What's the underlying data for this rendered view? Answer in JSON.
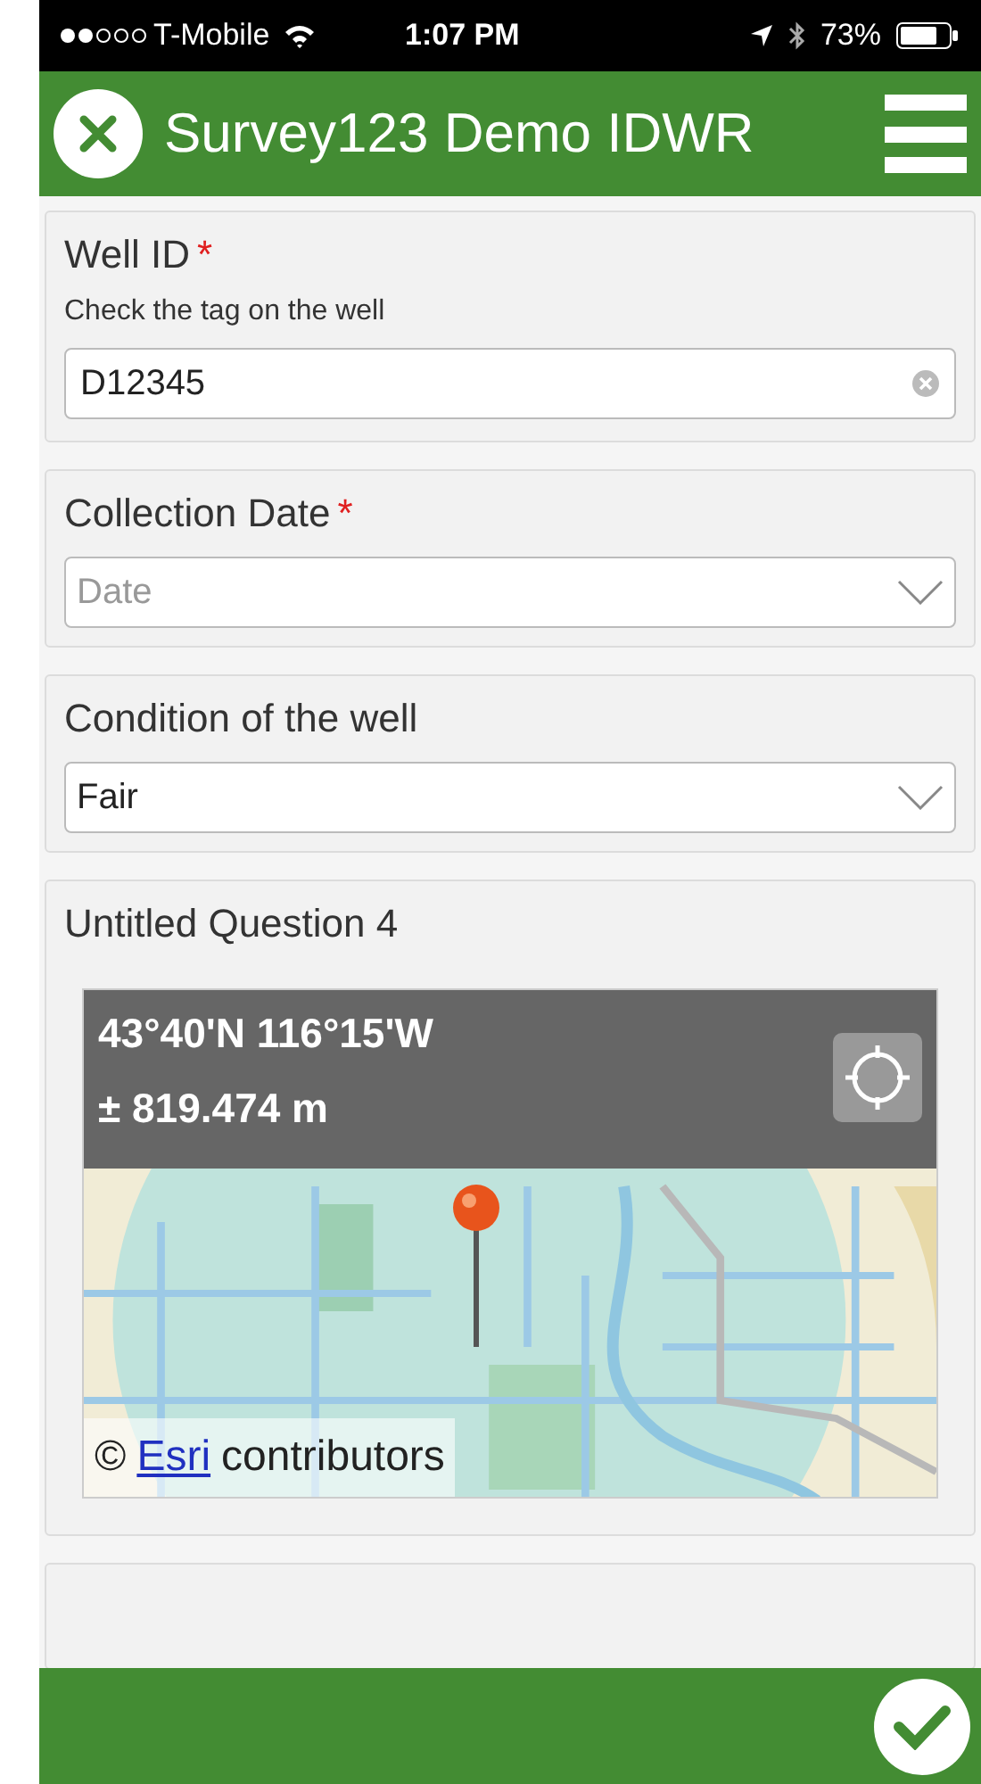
{
  "status_bar": {
    "carrier": "T-Mobile",
    "time": "1:07 PM",
    "battery": "73%"
  },
  "header": {
    "title": "Survey123 Demo IDWR"
  },
  "questions": [
    {
      "kind": "text",
      "label": "Well ID",
      "required_mark": "*",
      "hint": "Check the tag on the well",
      "value": "D12345"
    },
    {
      "kind": "select",
      "label": "Collection Date",
      "required_mark": "*",
      "placeholder": "Date"
    },
    {
      "kind": "select",
      "label": "Condition of the well",
      "value": "Fair"
    },
    {
      "kind": "map",
      "label": "Untitled Question 4",
      "coordinates": "43°40'N 116°15'W",
      "accuracy": "± 819.474 m",
      "attribution_symbol": "©",
      "attribution_link": "Esri",
      "attribution": "contributors"
    }
  ]
}
